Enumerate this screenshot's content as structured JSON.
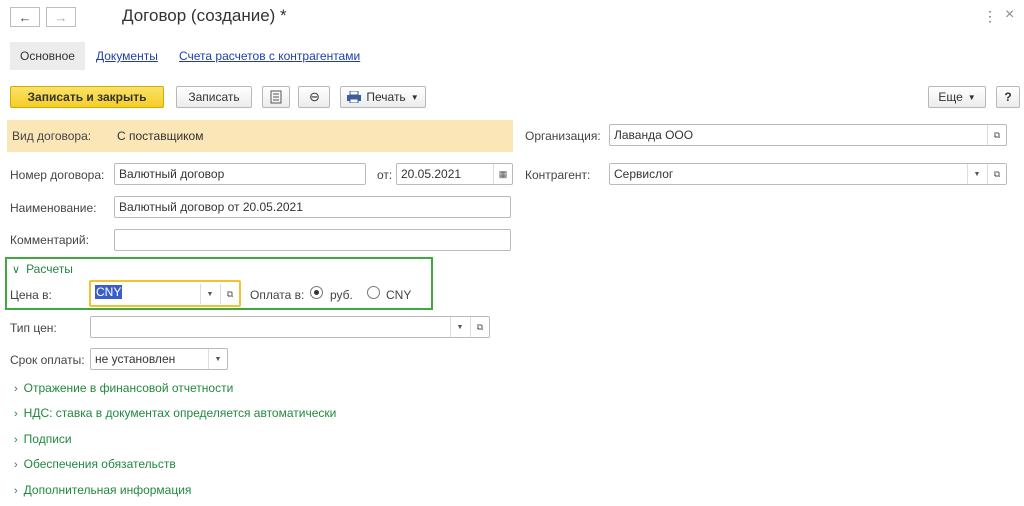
{
  "window": {
    "title": "Договор (создание) *",
    "more": "⋮",
    "close": "×"
  },
  "tabs": [
    {
      "label": "Основное"
    },
    {
      "label": "Документы"
    },
    {
      "label": "Счета расчетов с контрагентами"
    }
  ],
  "toolbar": {
    "save_close": "Записать и закрыть",
    "save": "Записать",
    "print": "Печать",
    "more": "Еще",
    "help": "?"
  },
  "form": {
    "contract_type_label": "Вид договора:",
    "contract_type_value": "С поставщиком",
    "org_label": "Организация:",
    "org_value": "Лаванда ООО",
    "number_label": "Номер договора:",
    "number_value": "Валютный договор",
    "from_label": "от:",
    "from_value": "20.05.2021",
    "counterparty_label": "Контрагент:",
    "counterparty_value": "Сервислог",
    "name_label": "Наименование:",
    "name_value": "Валютный договор от 20.05.2021",
    "comment_label": "Комментарий:",
    "comment_value": ""
  },
  "settlements": {
    "header": "Расчеты",
    "price_in_label": "Цена в:",
    "price_in_value": "CNY",
    "pay_in_label": "Оплата в:",
    "radio_rub": "руб.",
    "radio_cny": "CNY",
    "selected": "руб."
  },
  "price_type_label": "Тип цен:",
  "price_type_value": "",
  "payment_term_label": "Срок оплаты:",
  "payment_term_value": "не установлен",
  "sections": [
    "Отражение в финансовой отчетности",
    "НДС: ставка в документах определяется автоматически",
    "Подписи",
    "Обеспечения обязательств",
    "Дополнительная информация"
  ],
  "colors": {
    "accent_green": "#22883f",
    "highlight": "#fbe6b8",
    "focus": "#f2c230",
    "link": "#1f3fa8"
  }
}
